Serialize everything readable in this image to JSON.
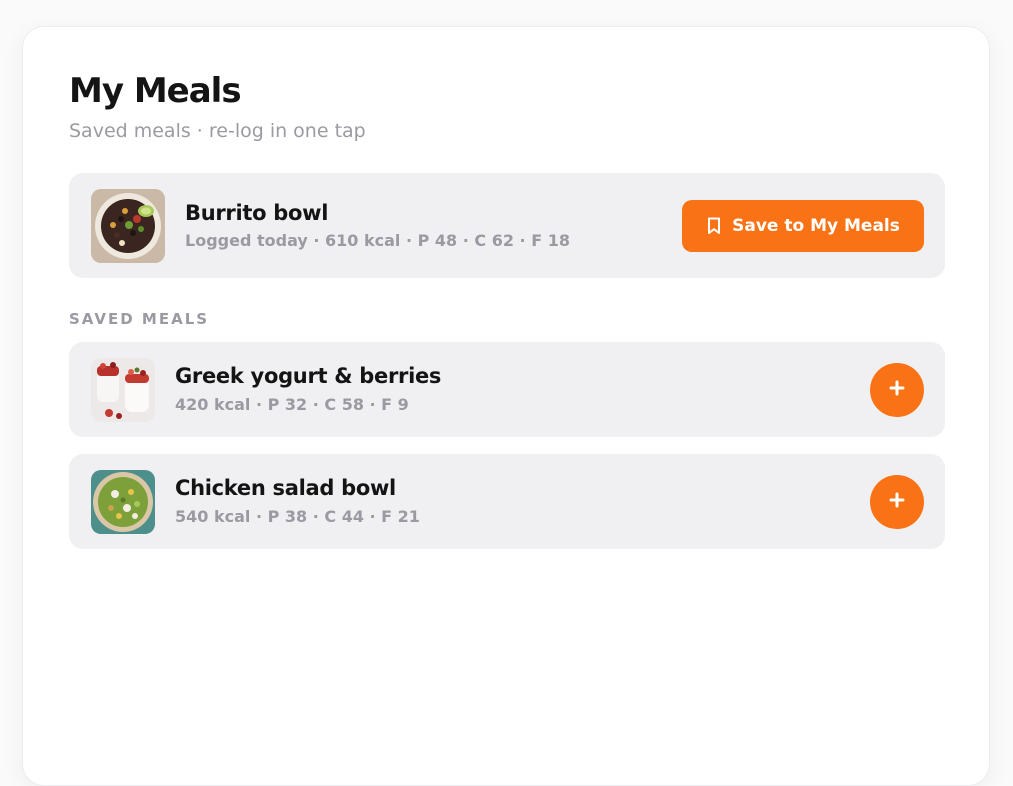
{
  "header": {
    "title": "My Meals",
    "subtitle": "Saved meals · re-log in one tap"
  },
  "featured": {
    "name": "Burrito bowl",
    "meta": "Logged today · 610 kcal · P 48 · C 62 · F 18",
    "save_label": "Save to My Meals",
    "icon": "bookmark-icon"
  },
  "saved_section": {
    "label": "SAVED MEALS"
  },
  "saved_meals": [
    {
      "name": "Greek yogurt & berries",
      "meta": "420 kcal · P 32 · C 58 · F 9",
      "action_icon": "plus-icon"
    },
    {
      "name": "Chicken salad bowl",
      "meta": "540 kcal · P 38 · C 44 · F 21",
      "action_icon": "plus-icon"
    }
  ],
  "colors": {
    "accent": "#f97316",
    "card_bg": "#f0f0f2",
    "muted_text": "#9a9aa2",
    "primary_text": "#141414"
  }
}
